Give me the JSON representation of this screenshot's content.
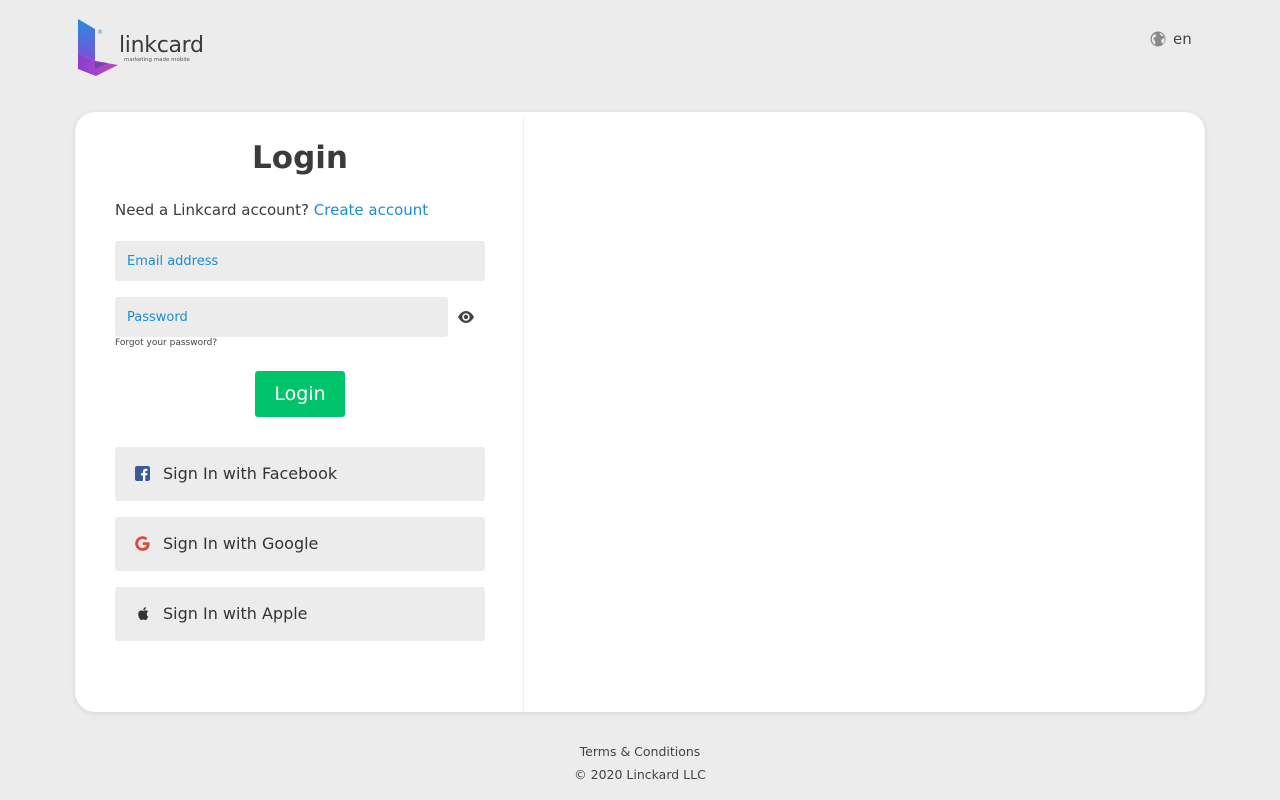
{
  "header": {
    "logo_text": "linkcard",
    "logo_tagline": "marketing made mobile",
    "logo_reg": "®",
    "language": "en",
    "language_icon": "globe-icon"
  },
  "login": {
    "title": "Login",
    "need_account_text": "Need a Linkcard account?",
    "create_account_label": "Create account",
    "email_placeholder": "Email address",
    "password_placeholder": "Password",
    "show_password_icon": "eye-icon",
    "forgot_label": "Forgot your password?",
    "submit_label": "Login"
  },
  "social": [
    {
      "label": "Sign In with Facebook",
      "icon": "facebook-icon",
      "color": "#3b5998"
    },
    {
      "label": "Sign In with Google",
      "icon": "google-icon",
      "color": "#dd4b39"
    },
    {
      "label": "Sign In with Apple",
      "icon": "apple-icon",
      "color": "#333333"
    }
  ],
  "footer": {
    "terms_label": "Terms & Conditions",
    "copyright": "© 2020 Linckard LLC"
  },
  "colors": {
    "background": "#ececec",
    "card": "#ffffff",
    "link": "#1a8fd1",
    "primary_button": "#00c46a",
    "input_bg": "#ececec"
  }
}
